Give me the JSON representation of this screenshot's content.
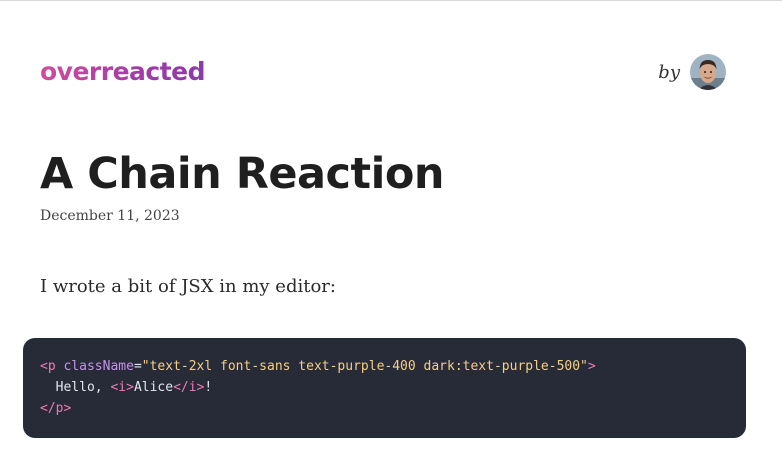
{
  "header": {
    "logo_text": "overreacted",
    "by_label": "by",
    "avatar_icon": "author-avatar",
    "logo_gradient": [
      "#d04d9d",
      "#8b3aa8"
    ]
  },
  "post": {
    "title": "A Chain Reaction",
    "date": "December 11, 2023",
    "intro": "I wrote a bit of JSX in my editor:"
  },
  "code": {
    "background": "#272a37",
    "lines": [
      {
        "tokens": [
          {
            "text": "<p",
            "kind": "tag"
          },
          {
            "text": " ",
            "kind": "text"
          },
          {
            "text": "className",
            "kind": "attr"
          },
          {
            "text": "=",
            "kind": "text"
          },
          {
            "text": "\"text-2xl font-sans text-purple-400 dark:text-purple-500\"",
            "kind": "str"
          },
          {
            "text": ">",
            "kind": "tag"
          }
        ]
      },
      {
        "tokens": [
          {
            "text": "  Hello, ",
            "kind": "text"
          },
          {
            "text": "<i>",
            "kind": "tag"
          },
          {
            "text": "Alice",
            "kind": "text"
          },
          {
            "text": "</i>",
            "kind": "tag"
          },
          {
            "text": "!",
            "kind": "text"
          }
        ]
      },
      {
        "tokens": [
          {
            "text": "</p>",
            "kind": "tag"
          }
        ]
      }
    ]
  }
}
